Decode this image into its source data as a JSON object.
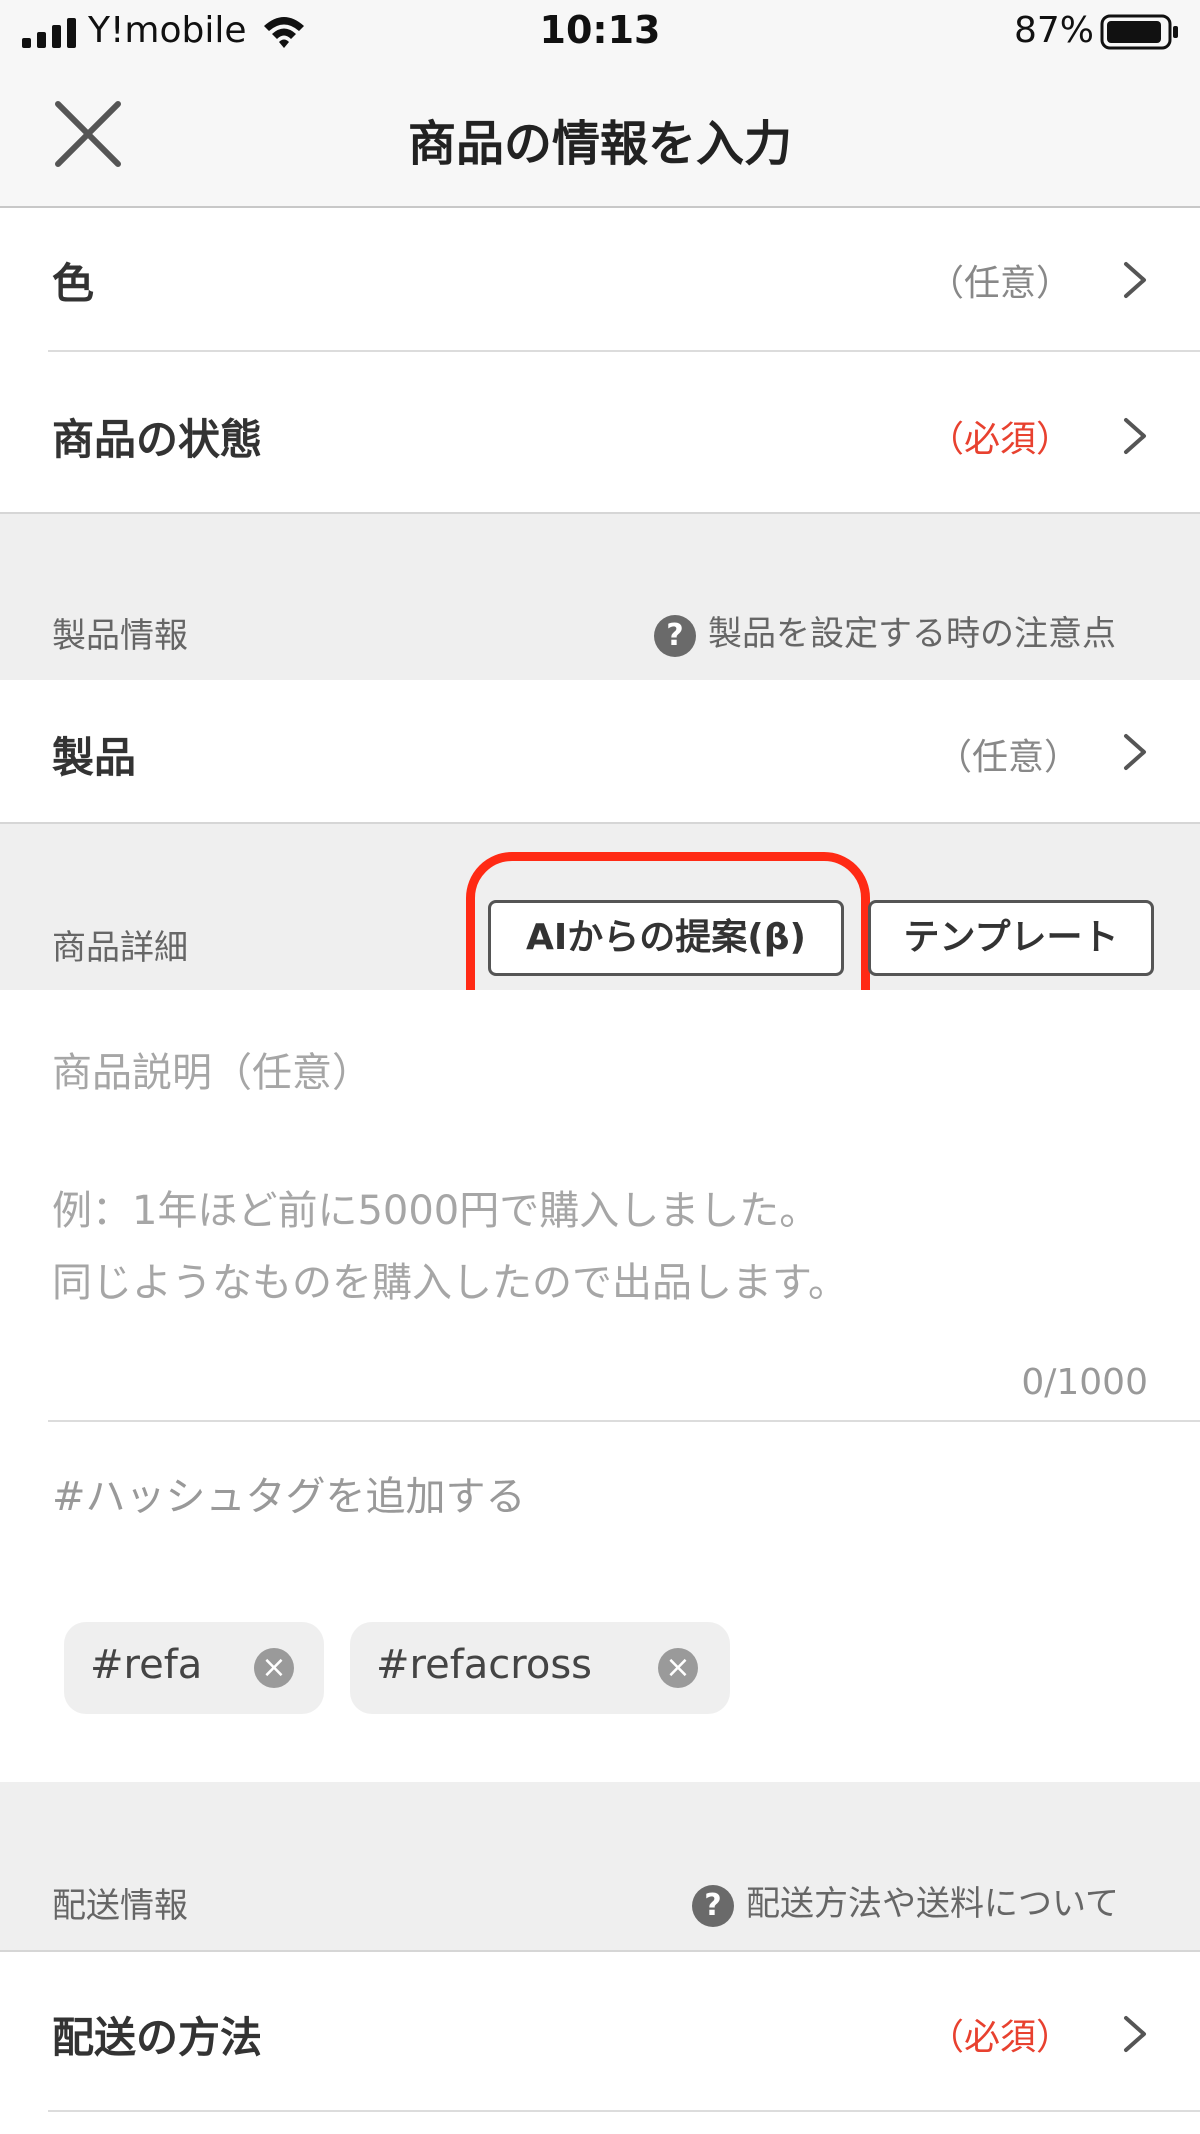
{
  "status_bar": {
    "carrier": "Y!mobile",
    "time": "10:13",
    "battery_percent": "87%"
  },
  "nav": {
    "title": "商品の情報を入力",
    "close_icon": "close-icon"
  },
  "rows": {
    "color": {
      "label": "色",
      "hint": "（任意）"
    },
    "condition": {
      "label": "商品の状態",
      "hint": "（必須）"
    }
  },
  "product_info": {
    "section_label": "製品情報",
    "help_text": "製品を設定する時の注意点",
    "product_row": {
      "label": "製品",
      "hint": "（任意）"
    }
  },
  "product_detail": {
    "section_label": "商品詳細",
    "ai_button": "AIからの提案(β)",
    "template_button": "テンプレート",
    "description_label": "商品説明（任意）",
    "description_placeholder_line1": "例：1年ほど前に5000円で購入しました。",
    "description_placeholder_line2": "同じようなものを購入したので出品します。",
    "counter": "0/1000",
    "hashtag_prompt": "#ハッシュタグを追加する",
    "tags": [
      "#refa",
      "#refacross"
    ]
  },
  "shipping_info": {
    "section_label": "配送情報",
    "help_text": "配送方法や送料について",
    "method_row": {
      "label": "配送の方法",
      "hint": "（必須）"
    }
  },
  "colors": {
    "required_red": "#e8412f",
    "highlight_ring": "#ff2a14",
    "section_bg": "#efefef"
  }
}
